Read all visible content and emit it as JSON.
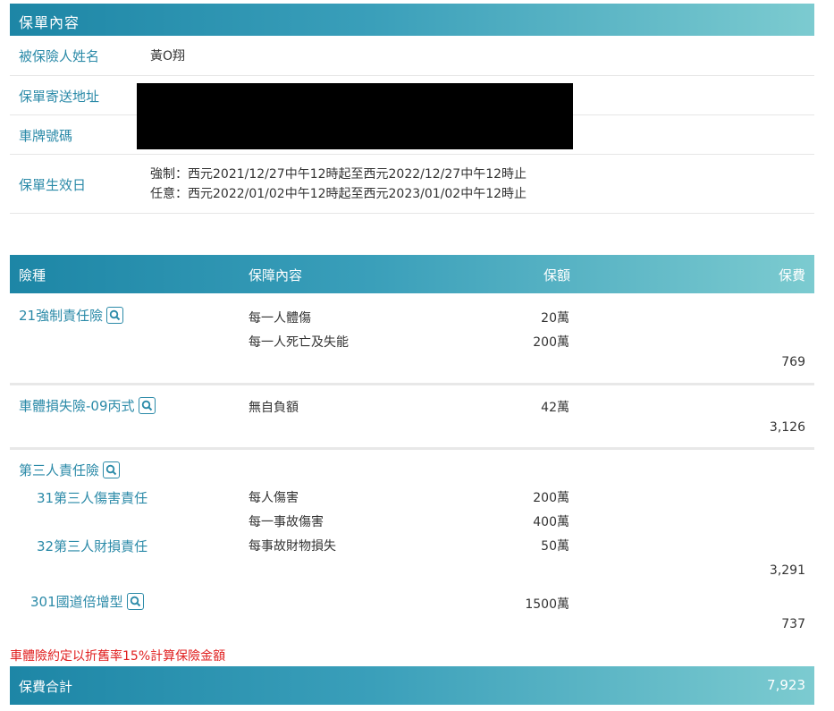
{
  "policy": {
    "section_title": "保單內容",
    "insured_label": "被保險人姓名",
    "insured_value": "黃O翔",
    "address_label": "保單寄送地址",
    "plate_label": "車牌號碼",
    "effective_label": "保單生效日",
    "effective_compulsory": "強制：西元2021/12/27中午12時起至西元2022/12/27中午12時止",
    "effective_voluntary": "任意：西元2022/01/02中午12時起至西元2023/01/02中午12時止"
  },
  "table": {
    "headers": {
      "type": "險種",
      "content": "保障內容",
      "amount": "保額",
      "premium": "保費"
    }
  },
  "coverages": [
    {
      "name": "21強制責任險",
      "details": [
        {
          "text": "每一人體傷",
          "amount": "20萬"
        },
        {
          "text": "每一人死亡及失能",
          "amount": "200萬"
        }
      ],
      "premium": "769"
    },
    {
      "name": "車體損失險-09丙式",
      "details": [
        {
          "text": "無自負額",
          "amount": "42萬"
        }
      ],
      "premium": "3,126"
    },
    {
      "name": "第三人責任險",
      "sub": [
        {
          "name": "31第三人傷害責任",
          "details": [
            {
              "text": "每人傷害",
              "amount": "200萬"
            },
            {
              "text": "每一事故傷害",
              "amount": "400萬"
            }
          ]
        },
        {
          "name": "32第三人財損責任",
          "details": [
            {
              "text": "每事故財物損失",
              "amount": "50萬"
            }
          ]
        }
      ],
      "premium": "3,291"
    },
    {
      "name": "301國道倍增型",
      "amount": "1500萬",
      "premium": "737"
    }
  ],
  "note": "車體險約定以折舊率15%計算保險金額",
  "total": {
    "label": "保費合計",
    "value": "7,923"
  },
  "icons": {
    "detail_icon": "search-icon"
  },
  "colors": {
    "accent": "#2b8aa8",
    "note": "#e02020",
    "bar_start": "#1d86a6",
    "bar_end": "#7ccbd0",
    "redaction": "#000000"
  }
}
